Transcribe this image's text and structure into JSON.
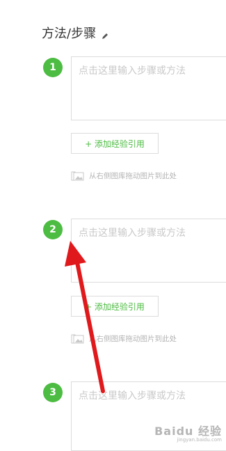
{
  "section": {
    "title": "方法/步骤",
    "edit_icon": "pencil-icon"
  },
  "steps": [
    {
      "number": "1",
      "placeholder": "点击这里输入步骤或方法",
      "ref_button_label": "+ 添加经验引用",
      "drag_hint": "从右侧图库拖动图片到此处"
    },
    {
      "number": "2",
      "placeholder": "点击这里输入步骤或方法",
      "ref_button_label": "+ 添加经验引用",
      "drag_hint": "从右侧图库拖动图片到此处"
    },
    {
      "number": "3",
      "placeholder": "点击这里输入步骤或方法"
    }
  ],
  "colors": {
    "accent": "#4cbc42",
    "annotation_arrow": "#e0191c"
  },
  "watermark": {
    "text": "Baidu 经验",
    "subtext": "jingyan.baidu.com"
  }
}
